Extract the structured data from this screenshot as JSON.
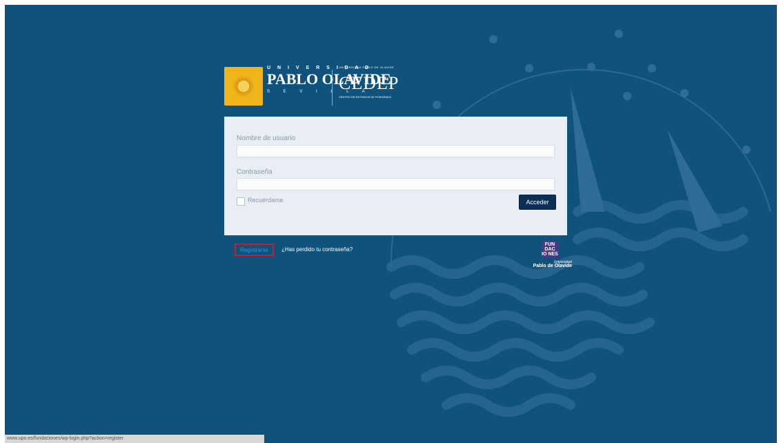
{
  "logos": {
    "upo_top": "U N I V E R S I D A D",
    "upo_mid": "PABLO OLAVIDE",
    "upo_bottom": "S E V I L L A",
    "cedep_small": "UNIVERSIDAD PABLO DE OLAVIDE",
    "cedep_big": "CEDEP",
    "cedep_small2": "CENTRO DE ESTUDIOS DE POSGRADO"
  },
  "form": {
    "username_label": "Nombre de usuario",
    "username_value": "",
    "password_label": "Contraseña",
    "password_value": "",
    "remember_label": "Recuérdame",
    "submit_label": "Acceder"
  },
  "links": {
    "register": "Registrarse",
    "lost_password": "¿Has perdido tu contraseña?"
  },
  "fundaciones": {
    "mark": "FUN DAC IO NES",
    "univ": "Universidad",
    "name": "Pablo de Olavide"
  },
  "status_bar": "www.upo.es/fundaciones/wp-login.php?action=register",
  "colors": {
    "background": "#0f537d",
    "button": "#0e2f55",
    "card": "#e8eef3",
    "highlight": "#c52029"
  }
}
